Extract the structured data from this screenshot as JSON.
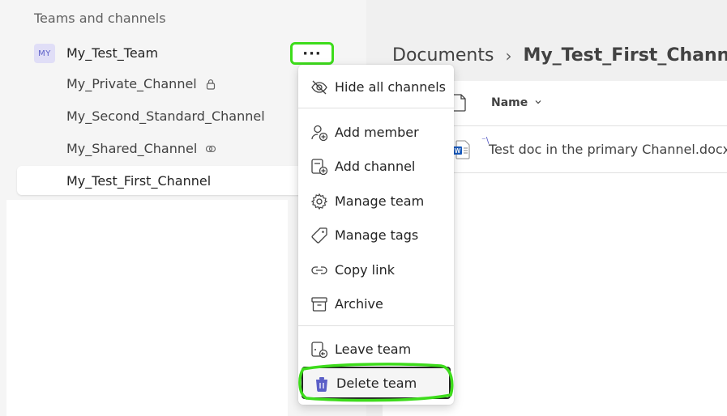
{
  "sidebar": {
    "section_header": "Teams and channels",
    "team": {
      "avatar_initials": "MY",
      "name": "My_Test_Team",
      "more_label": "···"
    },
    "channels": [
      {
        "name": "My_Private_Channel",
        "icon": "lock-icon"
      },
      {
        "name": "My_Second_Standard_Channel",
        "icon": ""
      },
      {
        "name": "My_Shared_Channel",
        "icon": "shared-channel-icon"
      },
      {
        "name": "My_Test_First_Channel",
        "icon": "",
        "active": true
      }
    ]
  },
  "breadcrumb": {
    "root": "Documents",
    "separator": "›",
    "current": "My_Test_First_Channel"
  },
  "documents": {
    "column_name": "Name",
    "files": [
      {
        "name": "Test doc in the primary Channel.docx",
        "icon": "word-file-icon"
      }
    ]
  },
  "menu": {
    "items": [
      {
        "label": "Hide all channels",
        "icon": "eye-off-icon"
      },
      {
        "label": "Add member",
        "icon": "person-add-icon"
      },
      {
        "label": "Add channel",
        "icon": "channel-add-icon"
      },
      {
        "label": "Manage team",
        "icon": "gear-icon"
      },
      {
        "label": "Manage tags",
        "icon": "tag-icon"
      },
      {
        "label": "Copy link",
        "icon": "link-icon"
      },
      {
        "label": "Archive",
        "icon": "archive-icon"
      },
      {
        "label": "Leave team",
        "icon": "leave-icon"
      },
      {
        "label": "Delete team",
        "icon": "trash-icon"
      }
    ]
  },
  "colors": {
    "accent": "#5b5fc7",
    "highlight": "#3ddc1b"
  }
}
